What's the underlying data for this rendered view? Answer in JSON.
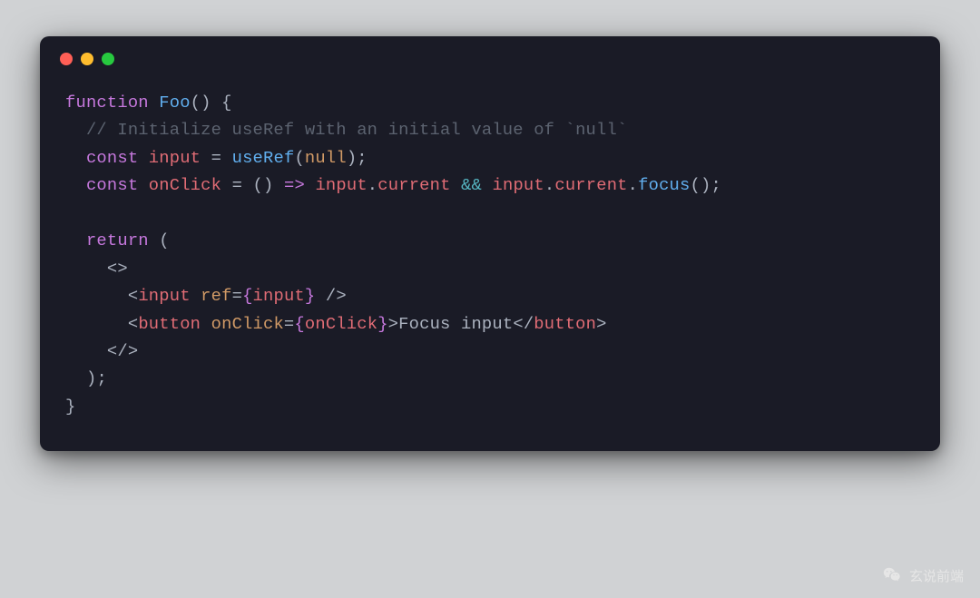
{
  "traffic_lights": {
    "red": "#ff5f56",
    "yellow": "#ffbd2e",
    "green": "#27c93f"
  },
  "code": {
    "line1": {
      "kw": "function",
      "fn": "Foo",
      "paren_open": "(",
      "paren_close": ")",
      "brace_open": "{"
    },
    "line2": {
      "comment": "// Initialize useRef with an initial value of `null`"
    },
    "line3": {
      "kw": "const",
      "ident": "input",
      "eq": "=",
      "fn": "useRef",
      "paren_open": "(",
      "null": "null",
      "paren_close": ")",
      "semi": ";"
    },
    "line4": {
      "kw": "const",
      "ident": "onClick",
      "eq": "=",
      "paren_open": "(",
      "paren_close": ")",
      "arrow": "=>",
      "obj1": "input",
      "dot1": ".",
      "prop1": "current",
      "and": "&&",
      "obj2": "input",
      "dot2": ".",
      "prop2": "current",
      "dot3": ".",
      "method": "focus",
      "po": "(",
      "pc": ")",
      "semi": ";"
    },
    "line5": {
      "kw": "return",
      "paren": "("
    },
    "line6": {
      "open": "<",
      "close": ">"
    },
    "line7": {
      "lt": "<",
      "tag": "input",
      "attr": "ref",
      "eq": "=",
      "jo": "{",
      "val": "input",
      "jc": "}",
      "slash": " /",
      "gt": ">"
    },
    "line8": {
      "lt": "<",
      "tag": "button",
      "attr": "onClick",
      "eq": "=",
      "jo": "{",
      "val": "onClick",
      "jc": "}",
      "gt": ">",
      "text": "Focus input",
      "clt": "</",
      "ctag": "button",
      "cgt": ">"
    },
    "line9": {
      "open": "</",
      "close": ">"
    },
    "line10": {
      "paren": ")",
      "semi": ";"
    },
    "line11": {
      "brace_close": "}"
    }
  },
  "watermark": {
    "label": "玄说前端"
  }
}
